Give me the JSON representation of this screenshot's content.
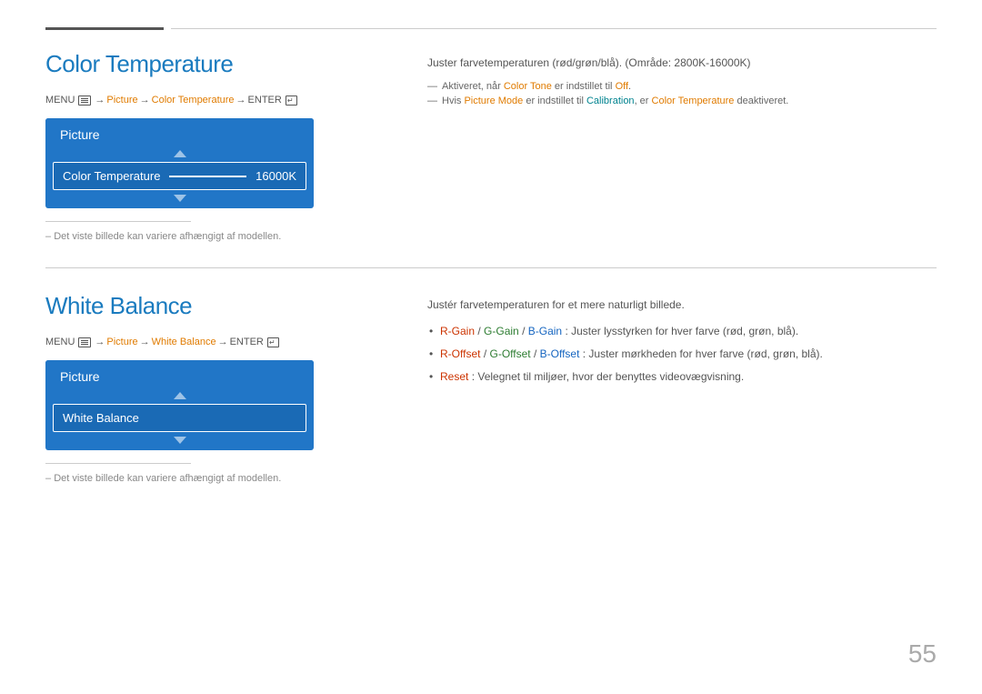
{
  "page": {
    "number": "55"
  },
  "section1": {
    "title": "Color Temperature",
    "menu_path": {
      "menu": "MENU",
      "arrow1": "→",
      "picture": "Picture",
      "arrow2": "→",
      "color_temperature": "Color Temperature",
      "arrow3": "→",
      "enter": "ENTER"
    },
    "picture_box": {
      "header": "Picture",
      "row_label": "Color Temperature",
      "row_value": "16000K"
    },
    "note": "Det viste billede kan variere afhængigt af modellen.",
    "description": {
      "intro": "Juster farvetemperaturen (rød/grøn/blå). (Område: 2800K-16000K)",
      "bullet1_prefix": "— Aktiveret, når ",
      "bullet1_highlight": "Color Tone",
      "bullet1_mid": " er indstillet til ",
      "bullet1_end": "Off",
      "bullet1_end_color": "orange",
      "bullet2_prefix": "— Hvis ",
      "bullet2_highlight": "Picture Mode",
      "bullet2_mid": " er indstillet til ",
      "bullet2_highlight2": "Calibration",
      "bullet2_end": ", er ",
      "bullet2_highlight3": "Color Temperature",
      "bullet2_final": " deaktiveret."
    }
  },
  "section2": {
    "title": "White Balance",
    "menu_path": {
      "menu": "MENU",
      "arrow1": "→",
      "picture": "Picture",
      "arrow2": "→",
      "white_balance": "White Balance",
      "arrow3": "→",
      "enter": "ENTER"
    },
    "picture_box": {
      "header": "Picture",
      "row_label": "White Balance"
    },
    "note": "Det viste billede kan variere afhængigt af modellen.",
    "description": {
      "intro": "Justér farvetemperaturen for et mere naturligt billede.",
      "items": [
        {
          "r_gain": "R-Gain",
          "slash1": " / ",
          "g_gain": "G-Gain",
          "slash2": " / ",
          "b_gain": "B-Gain",
          "text": ": Juster lysstyrken for hver farve (rød, grøn, blå)."
        },
        {
          "r_offset": "R-Offset",
          "slash1": " / ",
          "g_offset": "G-Offset",
          "slash2": " / ",
          "b_offset": "B-Offset",
          "text": ": Juster mørkheden for hver farve (rød, grøn, blå)."
        },
        {
          "reset": "Reset",
          "text": ": Velegnet til miljøer, hvor der benyttes videovægvisning."
        }
      ]
    }
  }
}
